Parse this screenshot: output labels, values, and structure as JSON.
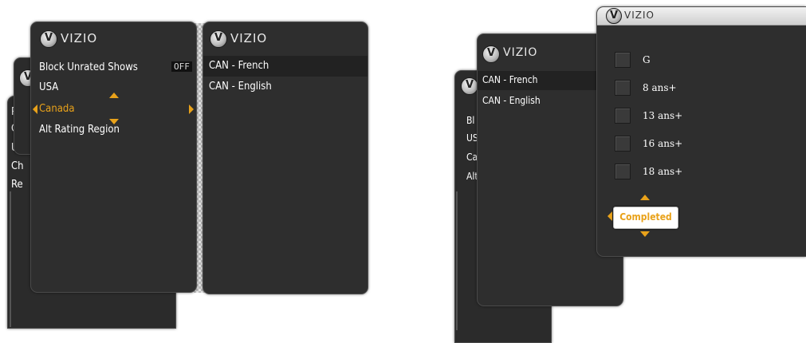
{
  "brand": {
    "logo": "VIZIO"
  },
  "left_screen": {
    "back_panel_items": [
      "Ra",
      "Ch",
      "Us",
      "Ch",
      "Re"
    ],
    "main_menu": {
      "items": [
        {
          "label": "Block Unrated Shows",
          "value": "OFF"
        },
        {
          "label": "USA"
        },
        {
          "label": "Canada",
          "selected": true
        },
        {
          "label": "Alt Rating Region"
        }
      ]
    },
    "submenu": {
      "items": [
        {
          "label": "CAN - French",
          "highlighted": true
        },
        {
          "label": "CAN - English"
        }
      ]
    }
  },
  "right_screen": {
    "back_panel_items": [
      "Bl",
      "US",
      "Ca",
      "Alt"
    ],
    "submenu": {
      "items": [
        {
          "label": "CAN - French",
          "highlighted": true
        },
        {
          "label": "CAN - English"
        }
      ]
    },
    "ratings_dialog": {
      "ratings": [
        {
          "label": "G",
          "checked": false
        },
        {
          "label": "8 ans+",
          "checked": false
        },
        {
          "label": "13 ans+",
          "checked": false
        },
        {
          "label": "16 ans+",
          "checked": false
        },
        {
          "label": "18 ans+",
          "checked": false
        }
      ],
      "completed_button": "Completed"
    }
  },
  "colors": {
    "accent": "#e9a21a",
    "panel": "#2e2e2e",
    "highlight": "#222222"
  }
}
